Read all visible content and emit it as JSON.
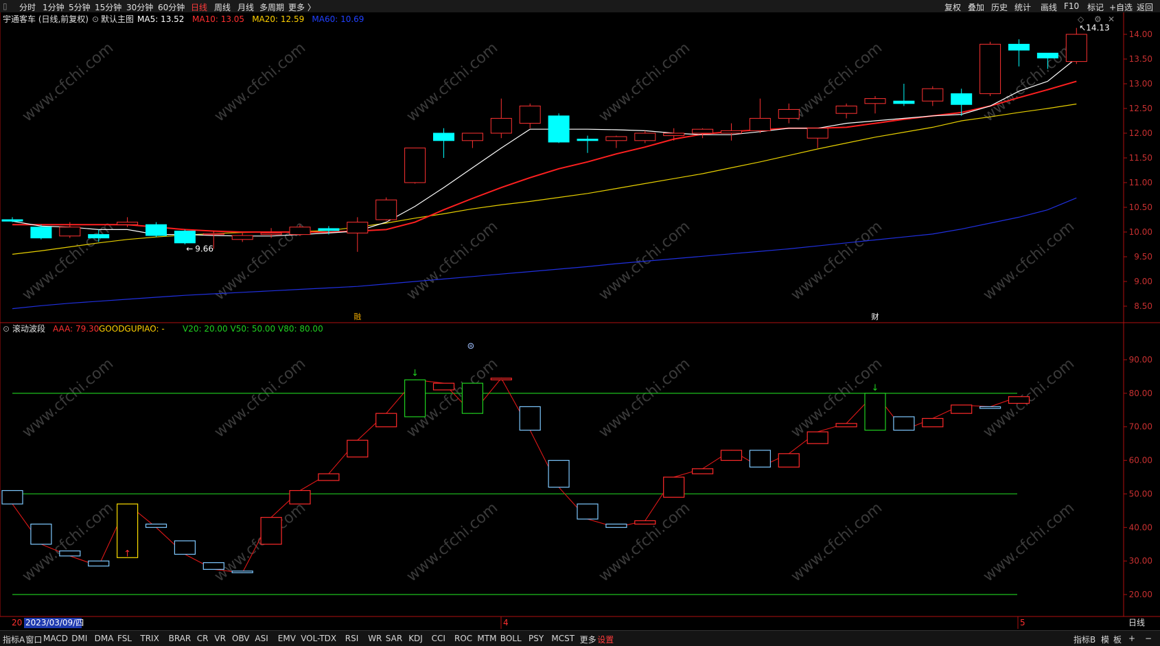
{
  "toolbar": {
    "periods": [
      "分时",
      "1分钟",
      "5分钟",
      "15分钟",
      "30分钟",
      "60分钟",
      "日线",
      "周线",
      "月线",
      "多周期",
      "更多 〉"
    ],
    "active_period": "日线",
    "actions": [
      "复权",
      "叠加",
      "历史",
      "统计",
      "画线",
      "F10",
      "标记",
      "+自选",
      "返回"
    ]
  },
  "main_panel": {
    "stock": "宇通客车 (日线,前复权)",
    "chart_name": "默认主图",
    "ma_labels": [
      {
        "text": "MA5: 13.52",
        "color": "#ffffff"
      },
      {
        "text": "MA10: 13.05",
        "color": "#ff3030"
      },
      {
        "text": "MA20: 12.59",
        "color": "#ffd000"
      },
      {
        "text": "MA60: 10.69",
        "color": "#2040ff"
      }
    ],
    "high_label": "14.13",
    "low_label": "9.66",
    "markers": [
      "融",
      "财"
    ],
    "price_ticks": [
      "14.00",
      "13.50",
      "13.00",
      "12.50",
      "12.00",
      "11.50",
      "11.00",
      "10.50",
      "10.00",
      "9.50",
      "9.00",
      "8.50"
    ]
  },
  "sub_panel": {
    "indicator": "滚动波段",
    "aaa": "AAA: 79.30",
    "goodgupiao": "GOODGUPIAO: -",
    "levels": "V20: 20.00  V50: 50.00  V80: 80.00",
    "ticks": [
      "90.00",
      "80.00",
      "70.00",
      "60.00",
      "50.00",
      "40.00",
      "30.00",
      "20.00"
    ]
  },
  "date_axis": {
    "cursor_date": "2023/03/09/四",
    "prefix": "20",
    "month4": "4",
    "month5": "5",
    "period": "日线"
  },
  "watermark": "www.cfchi.com",
  "bottombar": {
    "left": [
      "指标A",
      "窗口",
      "MACD",
      "DMI",
      "DMA",
      "FSL",
      "TRIX",
      "BRAR",
      "CR",
      "VR",
      "OBV",
      "ASI",
      "EMV",
      "VOL-TDX",
      "RSI",
      "WR",
      "SAR",
      "KDJ",
      "CCI",
      "ROC",
      "MTM",
      "BOLL",
      "PSY",
      "MCST",
      "更多"
    ],
    "settings": "设置",
    "right": [
      "指标B",
      "模",
      "板",
      "+",
      "−"
    ]
  },
  "colors": {
    "up": "#ff3232",
    "down": "#00ffff",
    "ma5": "#ffffff",
    "ma10": "#ff2020",
    "ma20": "#e8d000",
    "ma60": "#2030e0"
  },
  "chart_data": {
    "type": "candlestick",
    "candles": [
      {
        "o": 10.25,
        "h": 10.3,
        "l": 10.2,
        "c": 10.22
      },
      {
        "o": 10.1,
        "h": 10.15,
        "l": 9.85,
        "c": 9.88
      },
      {
        "o": 9.92,
        "h": 10.2,
        "l": 9.88,
        "c": 10.1
      },
      {
        "o": 9.95,
        "h": 10.05,
        "l": 9.8,
        "c": 9.88
      },
      {
        "o": 10.15,
        "h": 10.3,
        "l": 10.1,
        "c": 10.2
      },
      {
        "o": 10.15,
        "h": 10.2,
        "l": 9.9,
        "c": 9.93
      },
      {
        "o": 10.02,
        "h": 10.05,
        "l": 9.75,
        "c": 9.78
      },
      {
        "o": 9.95,
        "h": 10.02,
        "l": 9.66,
        "c": 9.97
      },
      {
        "o": 9.85,
        "h": 9.98,
        "l": 9.8,
        "c": 9.93
      },
      {
        "o": 9.95,
        "h": 10.08,
        "l": 9.88,
        "c": 9.98
      },
      {
        "o": 9.95,
        "h": 10.15,
        "l": 9.92,
        "c": 10.1
      },
      {
        "o": 10.07,
        "h": 10.12,
        "l": 9.95,
        "c": 10.03
      },
      {
        "o": 9.98,
        "h": 10.3,
        "l": 9.6,
        "c": 10.2
      },
      {
        "o": 10.25,
        "h": 10.7,
        "l": 10.23,
        "c": 10.65
      },
      {
        "o": 11.0,
        "h": 11.7,
        "l": 10.98,
        "c": 11.7
      },
      {
        "o": 12.0,
        "h": 12.1,
        "l": 11.5,
        "c": 11.85
      },
      {
        "o": 11.85,
        "h": 12.0,
        "l": 11.7,
        "c": 12.0
      },
      {
        "o": 12.0,
        "h": 12.7,
        "l": 11.9,
        "c": 12.3
      },
      {
        "o": 12.2,
        "h": 12.6,
        "l": 12.1,
        "c": 12.55
      },
      {
        "o": 12.35,
        "h": 12.4,
        "l": 11.8,
        "c": 11.82
      },
      {
        "o": 11.88,
        "h": 11.95,
        "l": 11.6,
        "c": 11.85
      },
      {
        "o": 11.85,
        "h": 11.95,
        "l": 11.7,
        "c": 11.93
      },
      {
        "o": 11.85,
        "h": 12.05,
        "l": 11.8,
        "c": 12.0
      },
      {
        "o": 11.95,
        "h": 12.1,
        "l": 11.85,
        "c": 12.0
      },
      {
        "o": 12.0,
        "h": 12.1,
        "l": 11.9,
        "c": 12.08
      },
      {
        "o": 12.0,
        "h": 12.2,
        "l": 11.85,
        "c": 12.05
      },
      {
        "o": 12.05,
        "h": 12.7,
        "l": 12.0,
        "c": 12.3
      },
      {
        "o": 12.3,
        "h": 12.6,
        "l": 12.2,
        "c": 12.48
      },
      {
        "o": 11.9,
        "h": 12.1,
        "l": 11.7,
        "c": 12.1
      },
      {
        "o": 12.4,
        "h": 12.6,
        "l": 12.3,
        "c": 12.55
      },
      {
        "o": 12.6,
        "h": 12.75,
        "l": 12.4,
        "c": 12.7
      },
      {
        "o": 12.65,
        "h": 13.0,
        "l": 12.55,
        "c": 12.6
      },
      {
        "o": 12.65,
        "h": 12.95,
        "l": 12.55,
        "c": 12.9
      },
      {
        "o": 12.8,
        "h": 12.9,
        "l": 12.35,
        "c": 12.58
      },
      {
        "o": 12.8,
        "h": 13.85,
        "l": 12.75,
        "c": 13.8
      },
      {
        "o": 13.8,
        "h": 13.9,
        "l": 13.35,
        "c": 13.68
      },
      {
        "o": 13.62,
        "h": 13.6,
        "l": 13.3,
        "c": 13.52
      },
      {
        "o": 13.45,
        "h": 14.13,
        "l": 13.4,
        "c": 14.0
      }
    ],
    "ma5": [
      10.22,
      10.12,
      10.1,
      10.05,
      10.05,
      9.95,
      9.95,
      9.93,
      9.92,
      9.92,
      9.95,
      9.98,
      10.02,
      10.2,
      10.52,
      10.9,
      11.3,
      11.7,
      12.08,
      12.08,
      12.08,
      12.07,
      12.05,
      12.0,
      11.97,
      11.97,
      12.03,
      12.1,
      12.1,
      12.2,
      12.25,
      12.3,
      12.35,
      12.38,
      12.55,
      12.85,
      13.05,
      13.52
    ],
    "ma10": [
      10.15,
      10.15,
      10.15,
      10.15,
      10.15,
      10.1,
      10.05,
      10.02,
      10.0,
      10.0,
      10.0,
      10.0,
      10.02,
      10.05,
      10.2,
      10.45,
      10.68,
      10.9,
      11.1,
      11.28,
      11.42,
      11.58,
      11.72,
      11.88,
      11.98,
      12.03,
      12.07,
      12.1,
      12.1,
      12.12,
      12.2,
      12.28,
      12.35,
      12.42,
      12.55,
      12.72,
      12.88,
      13.05
    ],
    "ma20": [
      9.55,
      9.62,
      9.7,
      9.78,
      9.85,
      9.9,
      9.94,
      9.97,
      9.99,
      10.0,
      10.01,
      10.03,
      10.1,
      10.18,
      10.28,
      10.37,
      10.47,
      10.55,
      10.62,
      10.7,
      10.78,
      10.88,
      10.98,
      11.08,
      11.18,
      11.3,
      11.42,
      11.55,
      11.68,
      11.8,
      11.92,
      12.02,
      12.12,
      12.25,
      12.33,
      12.42,
      12.5,
      12.59
    ],
    "ma60": [
      8.45,
      8.51,
      8.56,
      8.6,
      8.64,
      8.68,
      8.72,
      8.75,
      8.78,
      8.81,
      8.84,
      8.87,
      8.9,
      8.95,
      9.0,
      9.05,
      9.1,
      9.15,
      9.2,
      9.25,
      9.3,
      9.36,
      9.41,
      9.46,
      9.51,
      9.56,
      9.61,
      9.66,
      9.72,
      9.78,
      9.84,
      9.9,
      9.96,
      10.06,
      10.18,
      10.3,
      10.45,
      10.69
    ],
    "band": {
      "lines": [
        20,
        50,
        80
      ],
      "bars": [
        {
          "o": 51,
          "c": 47,
          "k": "b"
        },
        {
          "o": 41,
          "c": 35,
          "k": "b"
        },
        {
          "o": 33,
          "c": 31.5,
          "k": "b"
        },
        {
          "o": 30,
          "c": 28.5,
          "k": "b"
        },
        {
          "o": 31,
          "c": 47,
          "k": "y"
        },
        {
          "o": 41,
          "c": 40,
          "k": "b"
        },
        {
          "o": 36,
          "c": 32,
          "k": "b"
        },
        {
          "o": 29.5,
          "c": 27.5,
          "k": "b"
        },
        {
          "o": 27,
          "c": 26.5,
          "k": "b"
        },
        {
          "o": 35,
          "c": 43,
          "k": "r"
        },
        {
          "o": 47,
          "c": 51,
          "k": "r"
        },
        {
          "o": 54,
          "c": 56,
          "k": "r"
        },
        {
          "o": 61,
          "c": 66,
          "k": "r"
        },
        {
          "o": 70,
          "c": 74,
          "k": "r"
        },
        {
          "o": 73,
          "c": 84,
          "k": "g"
        },
        {
          "o": 81,
          "c": 83,
          "k": "r"
        },
        {
          "o": 83,
          "c": 74,
          "k": "g"
        },
        {
          "o": 84,
          "c": 84.5,
          "k": "r"
        },
        {
          "o": 76,
          "c": 69,
          "k": "b"
        },
        {
          "o": 60,
          "c": 52,
          "k": "b"
        },
        {
          "o": 47,
          "c": 42.5,
          "k": "b"
        },
        {
          "o": 41,
          "c": 40,
          "k": "b"
        },
        {
          "o": 41,
          "c": 42,
          "k": "r"
        },
        {
          "o": 49,
          "c": 55,
          "k": "r"
        },
        {
          "o": 56,
          "c": 57.5,
          "k": "r"
        },
        {
          "o": 60,
          "c": 63,
          "k": "r"
        },
        {
          "o": 63,
          "c": 58,
          "k": "b"
        },
        {
          "o": 58,
          "c": 62,
          "k": "r"
        },
        {
          "o": 65,
          "c": 68.5,
          "k": "r"
        },
        {
          "o": 70,
          "c": 71,
          "k": "r"
        },
        {
          "o": 69,
          "c": 80,
          "k": "g"
        },
        {
          "o": 73,
          "c": 69,
          "k": "b"
        },
        {
          "o": 70,
          "c": 72.5,
          "k": "r"
        },
        {
          "o": 74,
          "c": 76.5,
          "k": "r"
        },
        {
          "o": 75.5,
          "c": 76,
          "k": "b"
        },
        {
          "o": 77,
          "c": 79,
          "k": "r"
        }
      ]
    }
  }
}
